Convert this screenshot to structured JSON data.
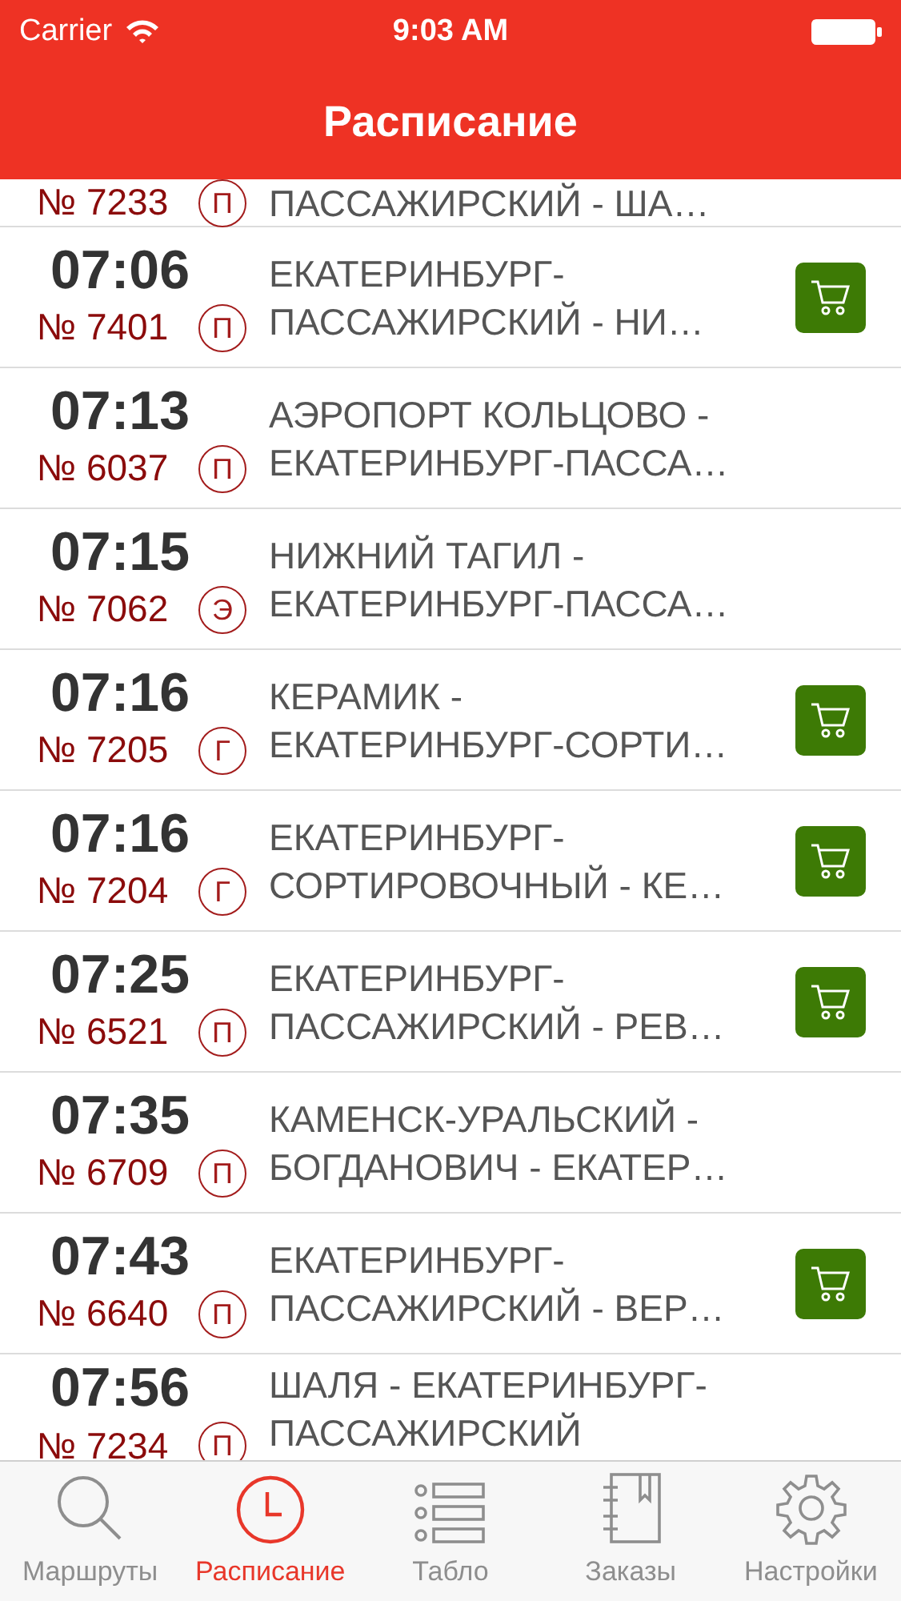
{
  "status_bar": {
    "carrier": "Carrier",
    "time": "9:03 AM"
  },
  "nav": {
    "title": "Расписание"
  },
  "partial_row": {
    "number": "№ 7233",
    "type": "П",
    "route_line": "ПАССАЖИРСКИЙ - ША…"
  },
  "rows": [
    {
      "time": "07:06",
      "number": "№ 7401",
      "type": "П",
      "route_lines": [
        "ЕКАТЕРИНБУРГ-",
        "ПАССАЖИРСКИЙ - НИ…"
      ],
      "ticket_available": true
    },
    {
      "time": "07:13",
      "number": "№ 6037",
      "type": "П",
      "route_lines": [
        "АЭРОПОРТ КОЛЬЦОВО -",
        "ЕКАТЕРИНБУРГ-ПАССА…"
      ],
      "ticket_available": false
    },
    {
      "time": "07:15",
      "number": "№ 7062",
      "type": "Э",
      "route_lines": [
        "НИЖНИЙ ТАГИЛ -",
        "ЕКАТЕРИНБУРГ-ПАССА…"
      ],
      "ticket_available": false
    },
    {
      "time": "07:16",
      "number": "№ 7205",
      "type": "Г",
      "route_lines": [
        "КЕРАМИК -",
        "ЕКАТЕРИНБУРГ-СОРТИ…"
      ],
      "ticket_available": true
    },
    {
      "time": "07:16",
      "number": "№ 7204",
      "type": "Г",
      "route_lines": [
        "ЕКАТЕРИНБУРГ-",
        "СОРТИРОВОЧНЫЙ - КЕ…"
      ],
      "ticket_available": true
    },
    {
      "time": "07:25",
      "number": "№ 6521",
      "type": "П",
      "route_lines": [
        "ЕКАТЕРИНБУРГ-",
        "ПАССАЖИРСКИЙ - РЕВ…"
      ],
      "ticket_available": true
    },
    {
      "time": "07:35",
      "number": "№ 6709",
      "type": "П",
      "route_lines": [
        "КАМЕНСК-УРАЛЬСКИЙ -",
        "БОГДАНОВИЧ - ЕКАТЕР…"
      ],
      "ticket_available": false
    },
    {
      "time": "07:43",
      "number": "№ 6640",
      "type": "П",
      "route_lines": [
        "ЕКАТЕРИНБУРГ-",
        "ПАССАЖИРСКИЙ - ВЕР…"
      ],
      "ticket_available": true
    },
    {
      "time": "07:56",
      "number": "№ 7234",
      "type": "П",
      "route_lines": [
        "ШАЛЯ - ЕКАТЕРИНБУРГ-",
        "ПАССАЖИРСКИЙ"
      ],
      "ticket_available": false
    }
  ],
  "tabs": [
    {
      "kind": "search",
      "label": "Маршруты",
      "selected": false
    },
    {
      "kind": "clock",
      "label": "Расписание",
      "selected": true
    },
    {
      "kind": "list",
      "label": "Табло",
      "selected": false
    },
    {
      "kind": "notebook",
      "label": "Заказы",
      "selected": false
    },
    {
      "kind": "gear",
      "label": "Настройки",
      "selected": false
    }
  ]
}
